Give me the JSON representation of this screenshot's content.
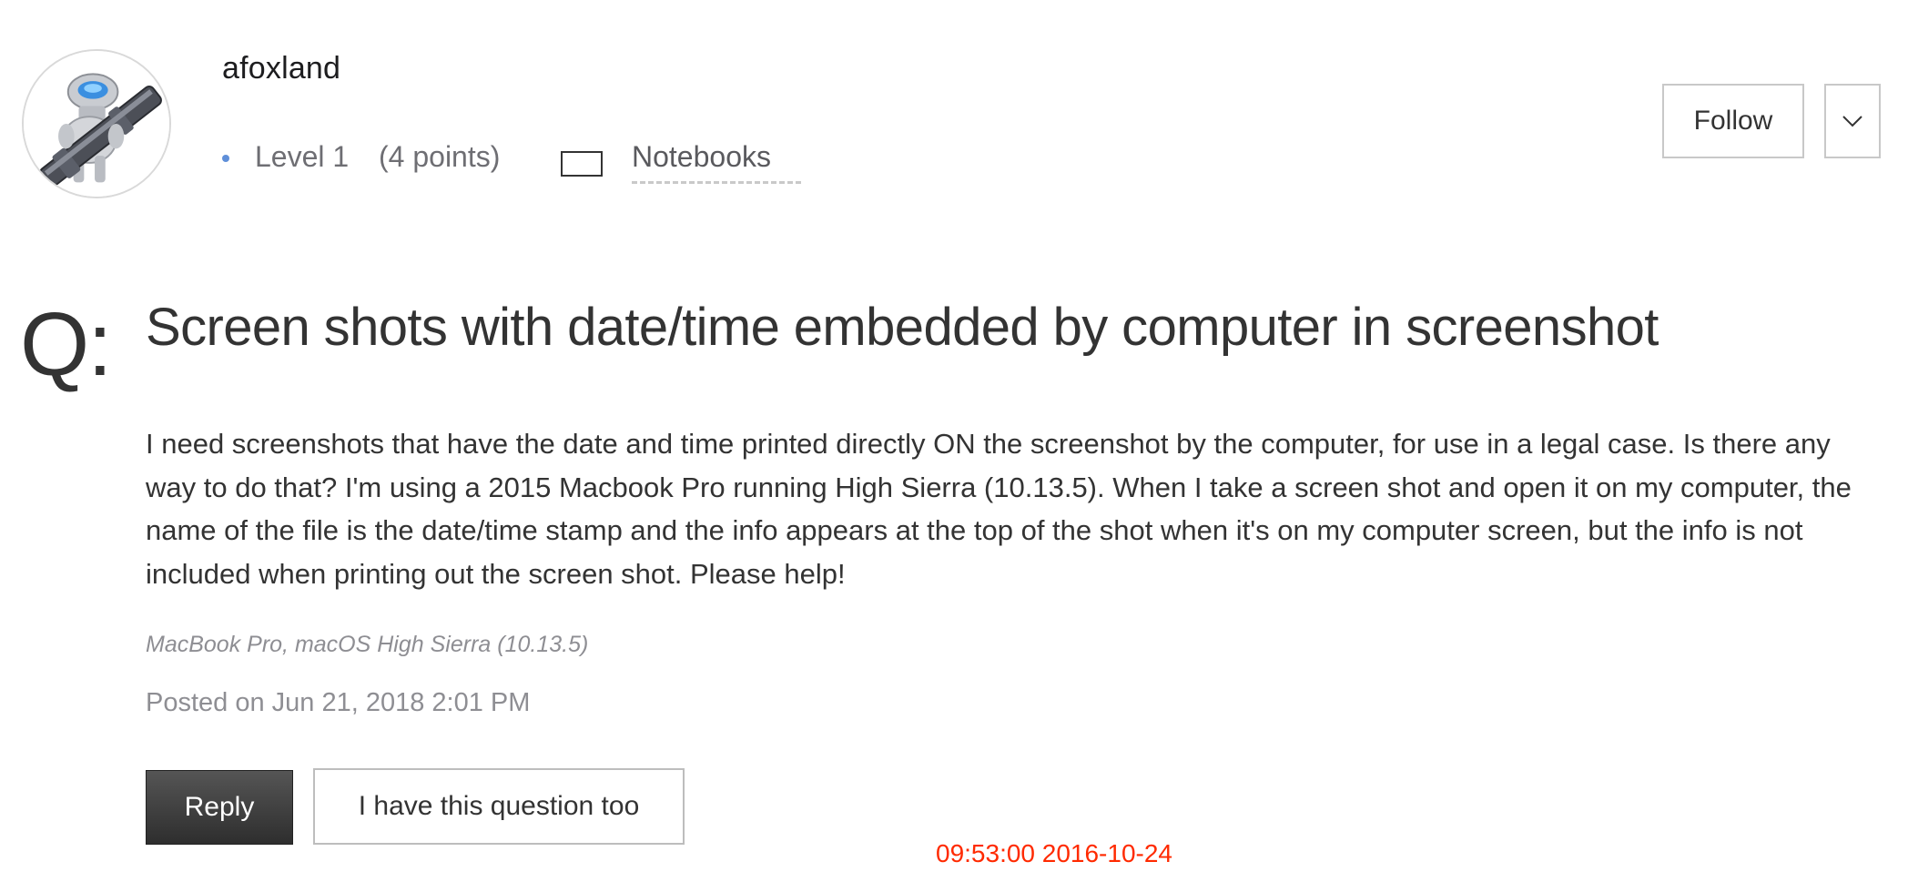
{
  "author": {
    "name": "afoxland",
    "level": "Level 1",
    "points": "(4 points)",
    "notebooks_label": "Notebooks",
    "follow_label": "Follow",
    "avatar_icon": "automator-robot-icon",
    "notebook_icon": "notebook-icon",
    "more_icon": "chevron-down-icon"
  },
  "question": {
    "prefix": "Q:",
    "title": "Screen shots with date/time embedded by computer in screenshot",
    "body": "I need screenshots that have the date and time printed directly ON the screenshot by the computer, for use in a legal case. Is there any way to do that? I'm using a 2015 Macbook Pro running High Sierra (10.13.5). When I take a screen shot and open it on my computer, the name of the file is the date/time stamp and the info appears at the top of the shot when it's on my computer screen, but the info is not included when printing out the screen shot. Please help!",
    "product": "MacBook Pro, macOS High Sierra (10.13.5)",
    "posted": "Posted on Jun 21, 2018 2:01 PM"
  },
  "actions": {
    "reply_label": "Reply",
    "same_question_label": "I have this question too"
  },
  "overlay": {
    "timestamp": "09:53:00 2016-10-24",
    "timestamp_color": "#ff2a00"
  },
  "colors": {
    "level_dot": "#5f8fd9",
    "reply_bg": "#3a3a3a",
    "text": "#333333",
    "muted": "#8e8e93"
  }
}
